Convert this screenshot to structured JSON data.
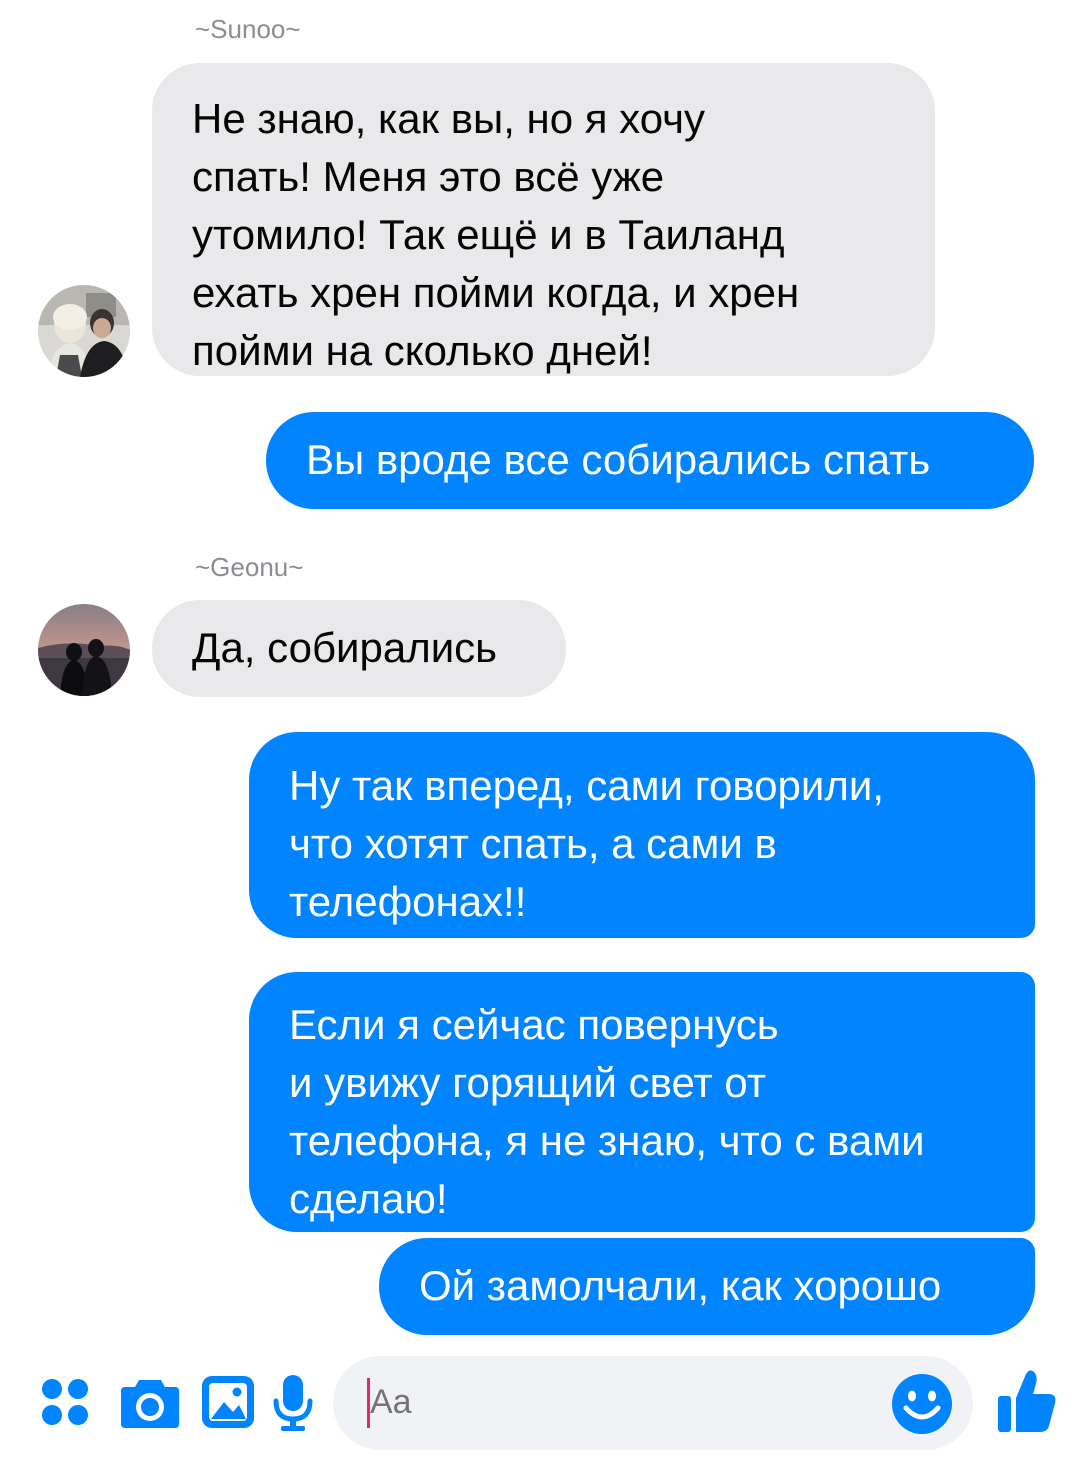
{
  "colors": {
    "outgoing_bubble": "#0084ff",
    "incoming_bubble": "#e9e9eb",
    "icon_accent": "#0084ff"
  },
  "messages": [
    {
      "sender_label": "~Sunoo~",
      "direction": "incoming",
      "text": "Не знаю, как вы, но я хочу\nспать! Меня это всё уже\nутомило! Так ещё и в Таиланд\nехать хрен пойми когда, и хрен\nпойми на сколько дней!"
    },
    {
      "direction": "outgoing",
      "text": "Вы вроде все собирались спать"
    },
    {
      "sender_label": "~Geonu~",
      "direction": "incoming",
      "text": "Да, собирались"
    },
    {
      "direction": "outgoing",
      "text": "Ну так вперед, сами говорили,\nчто хотят спать, а сами в\nтелефонах!!"
    },
    {
      "direction": "outgoing",
      "text": "Если я сейчас повернусь\nи увижу горящий свет от\nтелефона, я не знаю, что с вами\nсделаю!"
    },
    {
      "direction": "outgoing",
      "text": "Ой замолчали, как хорошо"
    }
  ],
  "composer": {
    "icons": [
      "apps-icon",
      "camera-icon",
      "gallery-icon",
      "microphone-icon",
      "emoji-icon",
      "like-icon"
    ],
    "placeholder": "Aa"
  }
}
